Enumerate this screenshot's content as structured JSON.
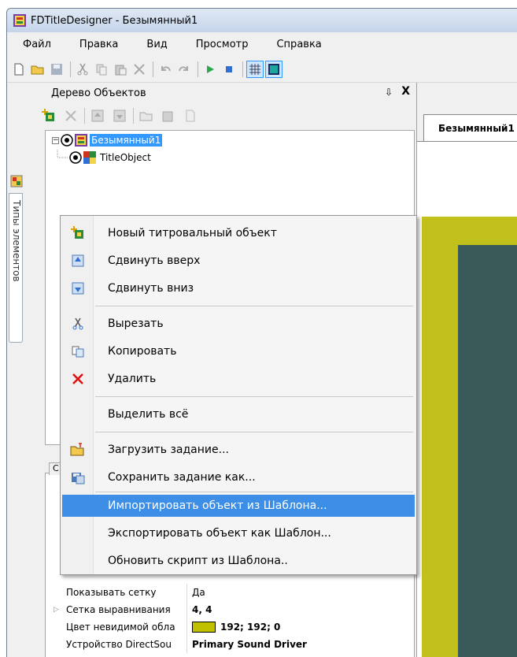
{
  "window": {
    "title": "FDTitleDesigner - Безымянный1"
  },
  "menubar": {
    "items": [
      "Файл",
      "Правка",
      "Вид",
      "Просмотр",
      "Справка"
    ]
  },
  "sidebar": {
    "tab_label": "Типы элементов"
  },
  "object_tree": {
    "title": "Дерево Объектов",
    "pin_glyph": "⇩",
    "close_glyph": "X",
    "nodes": [
      {
        "label": "Безымянный1",
        "selected": true
      },
      {
        "label": "TitleObject",
        "selected": false
      }
    ]
  },
  "document": {
    "tab_label": "Безымянный1"
  },
  "context_menu": {
    "items": [
      {
        "label": "Новый титровальный объект",
        "icon": "new-object-icon"
      },
      {
        "label": "Сдвинуть вверх",
        "icon": "move-up-icon"
      },
      {
        "label": "Сдвинуть вниз",
        "icon": "move-down-icon"
      },
      {
        "label": "Вырезать",
        "icon": "cut-icon"
      },
      {
        "label": "Копировать",
        "icon": "copy-icon"
      },
      {
        "label": "Удалить",
        "icon": "delete-icon"
      },
      {
        "label": "Выделить всё",
        "icon": ""
      },
      {
        "label": "Загрузить задание...",
        "icon": "open-folder-icon"
      },
      {
        "label": "Сохранить задание как...",
        "icon": "save-as-icon"
      },
      {
        "label": "Импортировать объект из Шаблона...",
        "icon": ""
      },
      {
        "label": "Экспортировать объект как  Шаблон...",
        "icon": ""
      },
      {
        "label": "Обновить скрипт из Шаблона..",
        "icon": ""
      }
    ],
    "highlighted_index": 9
  },
  "properties": {
    "tab_label": "С",
    "rows": [
      {
        "name": "Показывать сетку",
        "value": "Да"
      },
      {
        "name": "Сетка выравнивания",
        "value": "4, 4"
      },
      {
        "name": "Цвет невидимой обла",
        "value": "192; 192; 0",
        "swatch": "#c0c000"
      },
      {
        "name": "Устройство DirectSou",
        "value": "Primary Sound Driver"
      }
    ]
  },
  "colors": {
    "accent": "#3399ff",
    "highlight": "#3d8ee6",
    "canvas_yellow": "#c2c01a",
    "canvas_dark": "#3a5a5a"
  }
}
